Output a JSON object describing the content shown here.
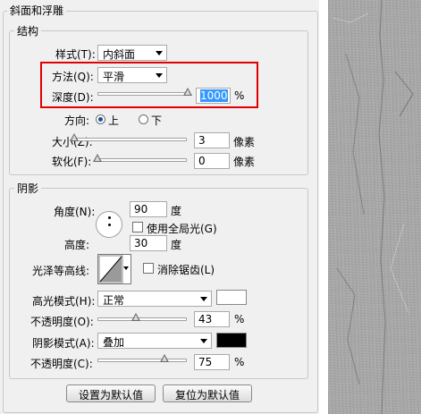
{
  "panel": {
    "title": "斜面和浮雕",
    "structure": {
      "legend": "结构",
      "style_label": "样式(T):",
      "style_value": "内斜面",
      "method_label": "方法(Q):",
      "method_value": "平滑",
      "depth_label": "深度(D):",
      "depth_value": "1000",
      "depth_unit": "%",
      "depth_fraction": 0.98,
      "direction_label": "方向:",
      "direction_up": "上",
      "direction_down": "下",
      "size_label": "大小(Z):",
      "size_value": "3",
      "size_unit": "像素",
      "size_fraction": 0.0,
      "soften_label": "软化(F):",
      "soften_value": "0",
      "soften_unit": "像素",
      "soften_fraction": 0.0
    },
    "shading": {
      "legend": "阴影",
      "angle_label": "角度(N):",
      "angle_value": "90",
      "angle_unit": "度",
      "global_light_label": "使用全局光(G)",
      "altitude_label": "高度:",
      "altitude_value": "30",
      "altitude_unit": "度",
      "gloss_contour_label": "光泽等高线:",
      "anti_aliased_label": "消除锯齿(L)",
      "highlight_mode_label": "高光模式(H):",
      "highlight_mode_value": "正常",
      "highlight_color": "#ffffff",
      "highlight_opacity_label": "不透明度(O):",
      "highlight_opacity_value": "43",
      "highlight_opacity_unit": "%",
      "highlight_opacity_fraction": 0.43,
      "shadow_mode_label": "阴影模式(A):",
      "shadow_mode_value": "叠加",
      "shadow_color": "#000000",
      "shadow_opacity_label": "不透明度(C):",
      "shadow_opacity_value": "75",
      "shadow_opacity_unit": "%",
      "shadow_opacity_fraction": 0.75
    },
    "buttons": {
      "make_default": "设置为默认值",
      "reset_default": "复位为默认值"
    },
    "highlight_box_color": "#e00000"
  }
}
